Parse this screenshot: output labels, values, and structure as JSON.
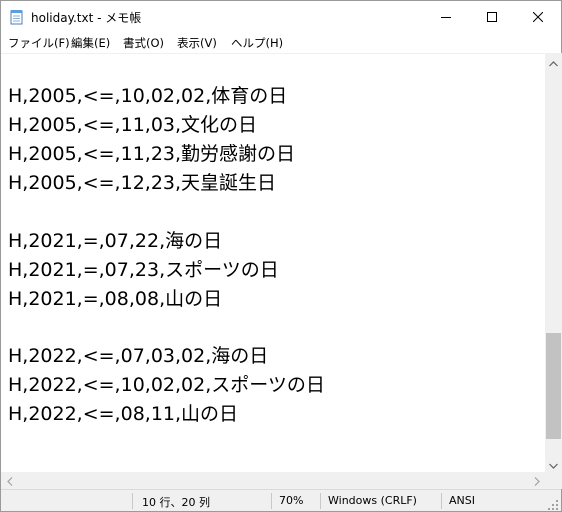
{
  "window": {
    "title": "holiday.txt - メモ帳"
  },
  "menu": [
    {
      "label": "ファイル(F)"
    },
    {
      "label": "編集(E)"
    },
    {
      "label": "書式(O)"
    },
    {
      "label": "表示(V)"
    },
    {
      "label": "ヘルプ(H)"
    }
  ],
  "editor": {
    "lines": [
      "",
      "H,2005,<=,10,02,02,体育の日",
      "H,2005,<=,11,03,文化の日",
      "H,2005,<=,11,23,勤労感謝の日",
      "H,2005,<=,12,23,天皇誕生日",
      "",
      "H,2021,=,07,22,海の日",
      "H,2021,=,07,23,スポーツの日",
      "H,2021,=,08,08,山の日",
      "",
      "H,2022,<=,07,03,02,海の日",
      "H,2022,<=,10,02,02,スポーツの日",
      "H,2022,<=,08,11,山の日"
    ]
  },
  "statusbar": {
    "position": "10 行、20 列",
    "zoom": "70%",
    "line_ending": "Windows (CRLF)",
    "encoding": "ANSI"
  },
  "icons": {
    "app": "notepad-icon",
    "minimize": "minimize-icon",
    "maximize": "maximize-icon",
    "close": "close-icon"
  }
}
